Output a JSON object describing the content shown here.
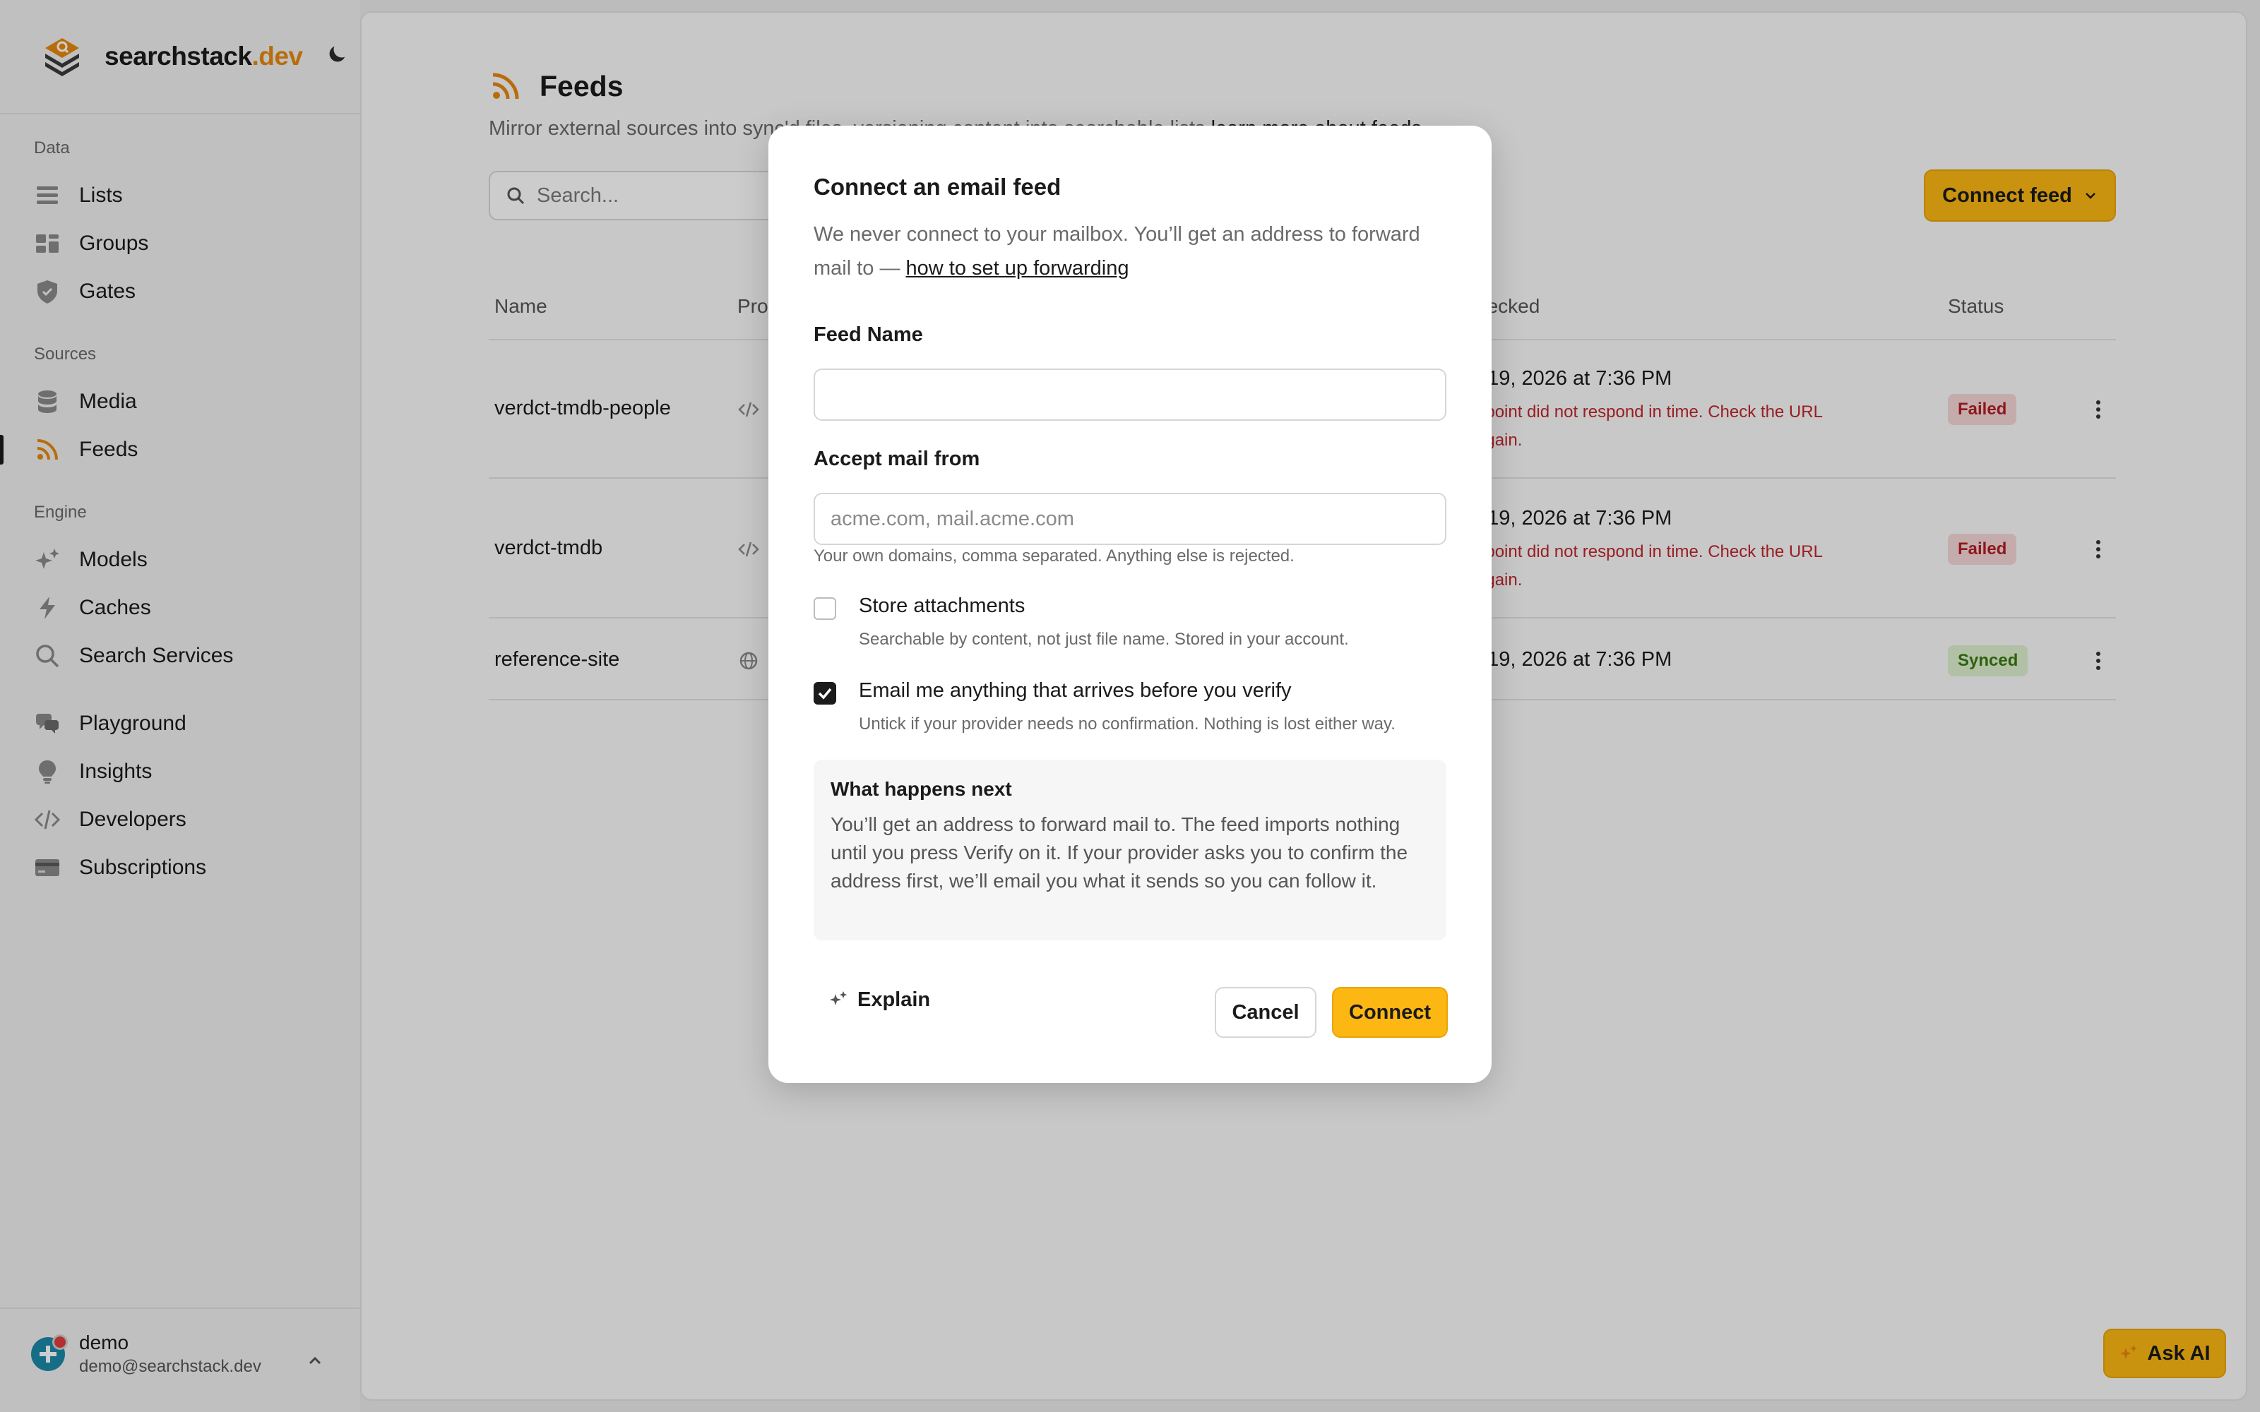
{
  "brand": {
    "name": "searchstack",
    "tld": ".dev"
  },
  "sidebar": {
    "sections": [
      {
        "label": "Data",
        "items": [
          {
            "label": "Lists",
            "icon": "list-icon"
          },
          {
            "label": "Groups",
            "icon": "groups-icon"
          },
          {
            "label": "Gates",
            "icon": "shield-icon"
          }
        ]
      },
      {
        "label": "Sources",
        "items": [
          {
            "label": "Media",
            "icon": "database-icon"
          },
          {
            "label": "Feeds",
            "icon": "rss-icon",
            "active": true
          }
        ]
      },
      {
        "label": "Engine",
        "items": [
          {
            "label": "Models",
            "icon": "sparkle-icon"
          },
          {
            "label": "Caches",
            "icon": "bolt-icon"
          },
          {
            "label": "Search Services",
            "icon": "search-icon"
          }
        ]
      },
      {
        "label": "",
        "items": [
          {
            "label": "Playground",
            "icon": "chat-icon"
          },
          {
            "label": "Insights",
            "icon": "lightbulb-icon"
          },
          {
            "label": "Developers",
            "icon": "code-icon"
          },
          {
            "label": "Subscriptions",
            "icon": "card-icon"
          }
        ]
      }
    ],
    "user": {
      "name": "demo",
      "email": "demo@searchstack.dev"
    }
  },
  "page": {
    "title": "Feeds",
    "subtitle_prefix": "Mirror external sources into syn",
    "subtitle_hidden": "c'd files, versioning content into searchable lists ",
    "subtitle_link": "learn more about feeds",
    "search_placeholder": "Search...",
    "connect_button": "Connect feed",
    "ask_ai": "Ask AI"
  },
  "table": {
    "headers": {
      "name": "Name",
      "provider": "Pro",
      "checked": "hecked",
      "status": "Status"
    },
    "rows": [
      {
        "name": "verdct-tmdb-people",
        "provider_icon": "code-icon",
        "checked": "t 19, 2026 at 7:36 PM",
        "error_line1": "dpoint did not respond in time. Check the URL",
        "error_line2": "again.",
        "status": "Failed"
      },
      {
        "name": "verdct-tmdb",
        "provider_icon": "code-icon",
        "checked": "t 19, 2026 at 7:36 PM",
        "error_line1": "dpoint did not respond in time. Check the URL",
        "error_line2": "again.",
        "status": "Failed"
      },
      {
        "name": "reference-site",
        "provider_icon": "globe-icon",
        "checked": "t 19, 2026 at 7:36 PM",
        "error_line1": "",
        "error_line2": "",
        "status": "Synced"
      }
    ]
  },
  "modal": {
    "title": "Connect an email feed",
    "description": "We never connect to your mailbox. You’ll get an address to forward mail to — ",
    "description_link": "how to set up forwarding",
    "feed_name_label": "Feed Name",
    "feed_name_value": "",
    "accept_label": "Accept mail from",
    "accept_placeholder": "acme.com, mail.acme.com",
    "accept_hint": "Your own domains, comma separated. Anything else is rejected.",
    "store_label": "Store attachments",
    "store_hint": "Searchable by content, not just file name. Stored in your account.",
    "store_checked": false,
    "email_label": "Email me anything that arrives before you verify",
    "email_hint": "Untick if your provider needs no confirmation. Nothing is lost either way.",
    "email_checked": true,
    "info_title": "What happens next",
    "info_body": "You’ll get an address to forward mail to. The feed imports nothing until you press Verify on it. If your provider asks you to confirm the address first, we’ll email you what it sends so you can follow it.",
    "explain": "Explain",
    "cancel": "Cancel",
    "connect": "Connect"
  },
  "colors": {
    "accent": "#fcb713",
    "brand_orange": "#e8870e",
    "failed": "#b31d25",
    "synced": "#3a7a12"
  }
}
